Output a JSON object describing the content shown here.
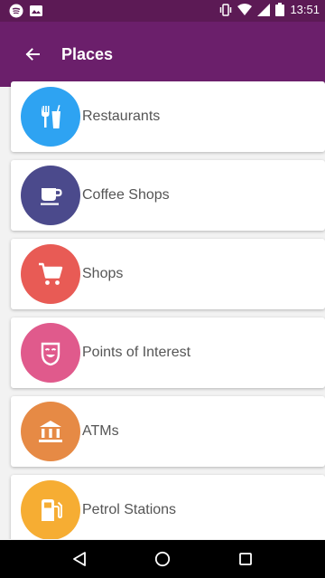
{
  "status_bar": {
    "time": "13:51",
    "icons": [
      "spotify-icon",
      "image-icon",
      "vibrate-icon",
      "wifi-icon",
      "signal-icon",
      "battery-icon"
    ]
  },
  "app_bar": {
    "title": "Places",
    "back_icon": "arrow-left-icon"
  },
  "places": [
    {
      "label": "Restaurants",
      "icon": "restaurant-icon",
      "color": "#2ea3f2"
    },
    {
      "label": "Coffee Shops",
      "icon": "coffee-icon",
      "color": "#4b4a8c"
    },
    {
      "label": "Shops",
      "icon": "shopping-cart-icon",
      "color": "#e85b55"
    },
    {
      "label": "Points of Interest",
      "icon": "theater-icon",
      "color": "#e05a8c"
    },
    {
      "label": "ATMs",
      "icon": "bank-icon",
      "color": "#e68a45"
    },
    {
      "label": "Petrol Stations",
      "icon": "fuel-icon",
      "color": "#f6ad33"
    }
  ],
  "nav_bar": {
    "back": "back-triangle-icon",
    "home": "home-circle-icon",
    "recents": "recents-square-icon"
  },
  "colors": {
    "status_bar": "#5c1a55",
    "app_bar": "#6b1f6b",
    "background": "#f2f2f2"
  }
}
